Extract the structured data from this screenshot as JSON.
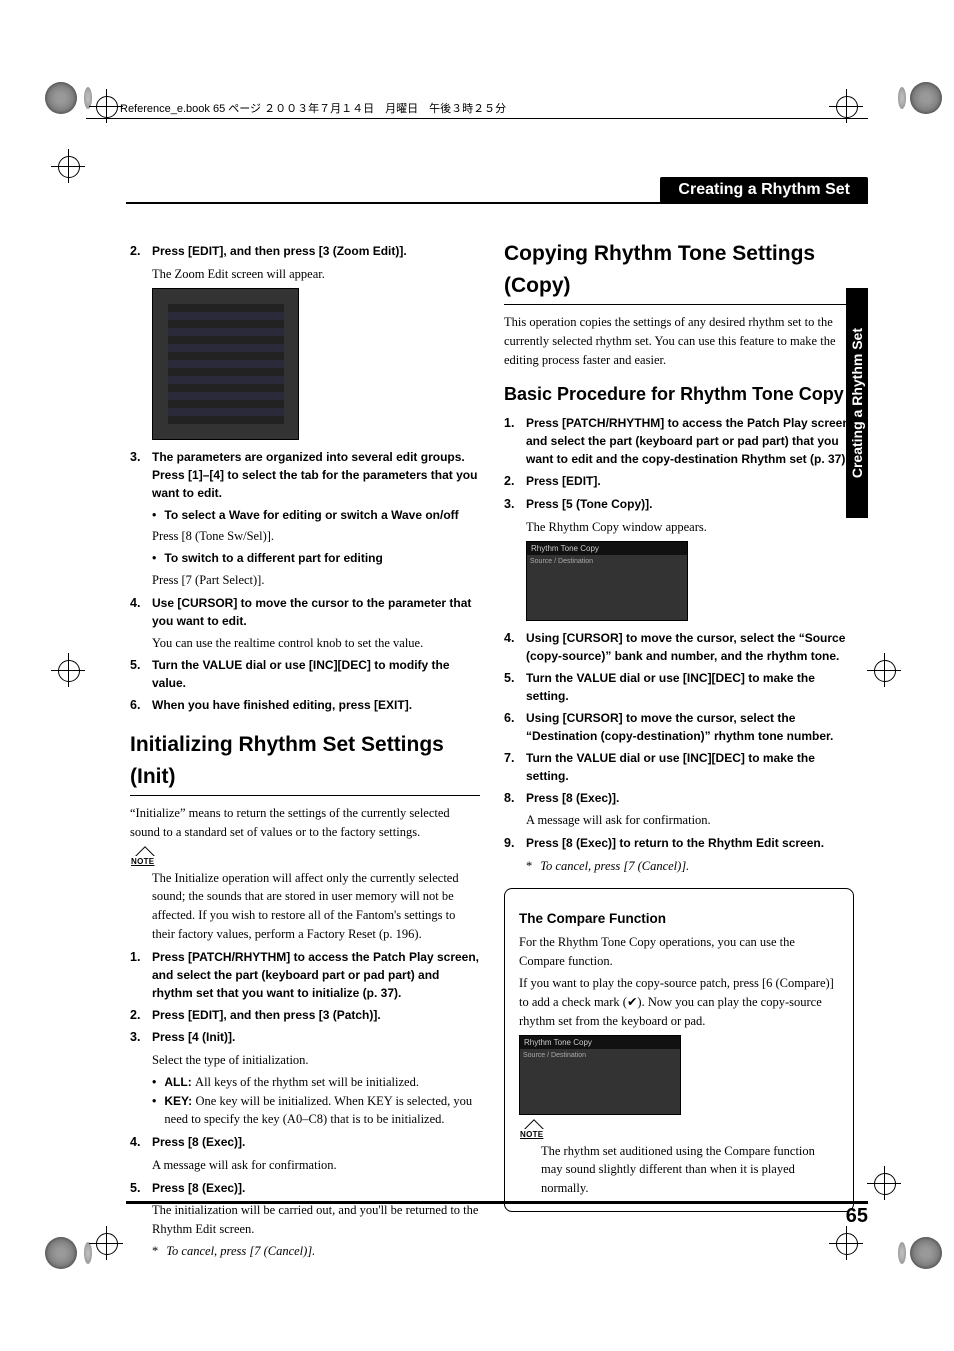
{
  "book_header": "Reference_e.book  65 ページ  ２００３年７月１４日　月曜日　午後３時２５分",
  "page_header": "Creating a Rhythm Set",
  "side_tab": "Creating a Rhythm Set",
  "page_number": "65",
  "left": {
    "s2": {
      "n": "2.",
      "bold": "Press [EDIT], and then press [3 (Zoom Edit)].",
      "body": "The Zoom Edit screen will appear."
    },
    "s3": {
      "n": "3.",
      "bold": "The parameters are organized into several edit groups. Press [1]–[4] to select the tab for the parameters that you want to edit."
    },
    "b1": {
      "bold": "To select a Wave for editing or switch a Wave on/off",
      "body": "Press [8 (Tone Sw/Sel)]."
    },
    "b2": {
      "bold": "To switch to a different part for editing",
      "body": "Press [7 (Part Select)]."
    },
    "s4": {
      "n": "4.",
      "bold": "Use [CURSOR] to move the cursor to the parameter that you want to edit.",
      "body": "You can use the realtime control knob to set the value."
    },
    "s5": {
      "n": "5.",
      "bold": "Turn the VALUE dial or use [INC][DEC] to modify the value."
    },
    "s6": {
      "n": "6.",
      "bold": "When you have finished editing, press [EXIT]."
    },
    "h_init": "Initializing Rhythm Set Settings (Init)",
    "init_intro": "“Initialize” means to return the settings of the currently selected sound to a standard set of values or to the factory settings.",
    "init_note": "The Initialize operation will affect only the currently selected sound; the sounds that are stored in user memory will not be affected. If you wish to restore all of the Fantom's settings to their factory values, perform a Factory Reset (p. 196).",
    "i1": {
      "n": "1.",
      "bold": "Press [PATCH/RHYTHM] to access the Patch Play screen, and select the part (keyboard part or pad part) and rhythm set that you want to initialize (p. 37)."
    },
    "i2": {
      "n": "2.",
      "bold": "Press [EDIT], and then press [3 (Patch)]."
    },
    "i3": {
      "n": "3.",
      "bold": "Press [4 (Init)].",
      "body": "Select the type of initialization."
    },
    "i3a": {
      "lead": "ALL: ",
      "text": "All keys of the rhythm set will be initialized."
    },
    "i3b": {
      "lead": "KEY: ",
      "text": "One key will be initialized. When KEY is selected, you need to specify the key (A0–C8) that is to be initialized."
    },
    "i4": {
      "n": "4.",
      "bold": "Press [8 (Exec)].",
      "body": "A message will ask for confirmation."
    },
    "i5": {
      "n": "5.",
      "bold": "Press [8 (Exec)].",
      "body": "The initialization will be carried out, and you'll be returned to the Rhythm Edit screen."
    },
    "i_cancel": "To cancel, press [7 (Cancel)]."
  },
  "right": {
    "h_copy": "Copying Rhythm Tone Settings (Copy)",
    "copy_intro": "This operation copies the settings of any desired rhythm set to the currently selected rhythm set. You can use this feature to make the editing process faster and easier.",
    "h_proc": "Basic Procedure for Rhythm Tone Copy",
    "c1": {
      "n": "1.",
      "bold": "Press [PATCH/RHYTHM] to access the Patch Play screen, and select the part (keyboard part or pad part) that you want to edit and the copy-destination Rhythm set (p. 37)."
    },
    "c2": {
      "n": "2.",
      "bold": "Press [EDIT]."
    },
    "c3": {
      "n": "3.",
      "bold": "Press [5 (Tone Copy)].",
      "body": "The Rhythm Copy window appears."
    },
    "c4": {
      "n": "4.",
      "bold": "Using [CURSOR] to move the cursor, select the “Source (copy-source)” bank and number, and the rhythm tone."
    },
    "c5": {
      "n": "5.",
      "bold": "Turn the VALUE dial or use [INC][DEC] to make the setting."
    },
    "c6": {
      "n": "6.",
      "bold": "Using [CURSOR] to move the cursor, select the “Destination (copy-destination)” rhythm tone number."
    },
    "c7": {
      "n": "7.",
      "bold": "Turn the VALUE dial or use [INC][DEC] to make the setting."
    },
    "c8": {
      "n": "8.",
      "bold": "Press [8 (Exec)].",
      "body": "A message will ask for confirmation."
    },
    "c9": {
      "n": "9.",
      "bold": " Press [8 (Exec)] to return to the Rhythm Edit screen."
    },
    "c_cancel": "To cancel, press [7 (Cancel)].",
    "compare_h": "The Compare Function",
    "compare_p1": "For the Rhythm Tone Copy operations, you can use the Compare function.",
    "compare_p2a": "If you want to play the copy-source patch, press [6 (Compare)] to add a check mark (",
    "compare_p2b": "). Now you can play the copy-source rhythm set from the keyboard or pad.",
    "compare_note": "The rhythm set auditioned using the Compare function may sound slightly different than when it is played normally."
  }
}
